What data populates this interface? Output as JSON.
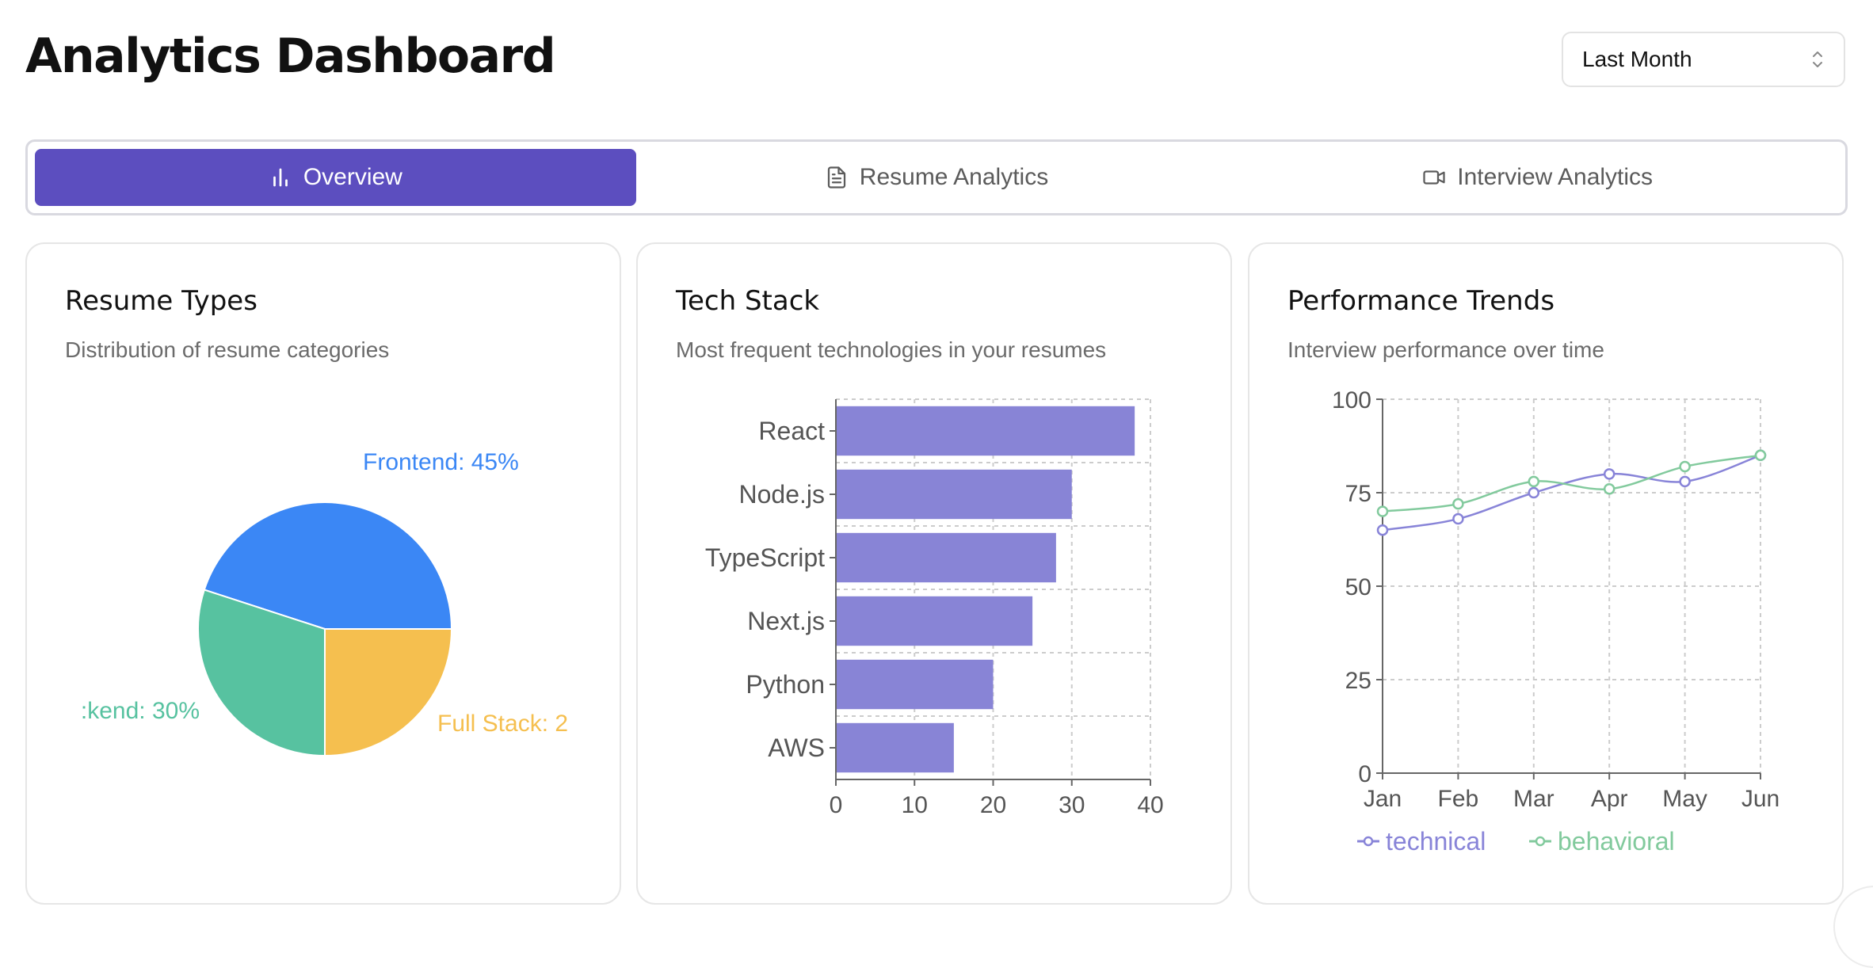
{
  "header": {
    "title": "Analytics Dashboard",
    "range_select": "Last Month"
  },
  "tabs": [
    {
      "label": "Overview",
      "icon": "bar-chart-icon",
      "active": true
    },
    {
      "label": "Resume Analytics",
      "icon": "document-icon",
      "active": false
    },
    {
      "label": "Interview Analytics",
      "icon": "video-icon",
      "active": false
    }
  ],
  "cards": {
    "resume_types": {
      "title": "Resume Types",
      "subtitle": "Distribution of resume categories"
    },
    "tech_stack": {
      "title": "Tech Stack",
      "subtitle": "Most frequent technologies in your resumes"
    },
    "performance": {
      "title": "Performance Trends",
      "subtitle": "Interview performance over time"
    }
  },
  "colors": {
    "accent": "#5c4ebf",
    "frontend": "#3b87f5",
    "backend": "#57c2a0",
    "fullstack": "#f5bf4f",
    "bar": "#8884d6",
    "technical": "#8884d8",
    "behavioral": "#82ca9d"
  },
  "chart_data": [
    {
      "type": "pie",
      "slices": [
        {
          "label": "Frontend",
          "value": 45,
          "display": "Frontend: 45%",
          "color": "#3b87f5"
        },
        {
          "label": "Full Stack",
          "value": 25,
          "display": "Full Stack: 2",
          "color": "#f5bf4f"
        },
        {
          "label": "Backend",
          "value": 30,
          "display": ":kend: 30%",
          "color": "#57c2a0"
        }
      ]
    },
    {
      "type": "bar",
      "orientation": "horizontal",
      "categories": [
        "React",
        "Node.js",
        "TypeScript",
        "Next.js",
        "Python",
        "AWS"
      ],
      "values": [
        38,
        30,
        28,
        25,
        20,
        15
      ],
      "xlim": [
        0,
        40
      ],
      "xticks": [
        0,
        10,
        20,
        30,
        40
      ],
      "grid": true
    },
    {
      "type": "line",
      "x": [
        "Jan",
        "Feb",
        "Mar",
        "Apr",
        "May",
        "Jun"
      ],
      "ylim": [
        0,
        100
      ],
      "yticks": [
        0,
        25,
        50,
        75,
        100
      ],
      "grid": true,
      "legend": "bottom",
      "series": [
        {
          "name": "technical",
          "values": [
            65,
            68,
            75,
            80,
            78,
            85
          ],
          "color": "#8884d8"
        },
        {
          "name": "behavioral",
          "values": [
            70,
            72,
            78,
            76,
            82,
            85
          ],
          "color": "#82ca9d"
        }
      ]
    }
  ]
}
